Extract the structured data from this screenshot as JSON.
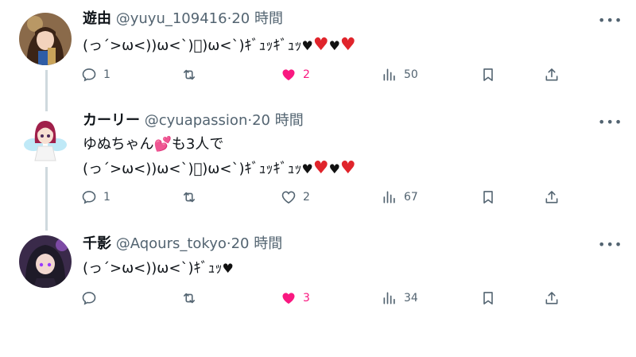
{
  "tweets": [
    {
      "name": "遊由",
      "handle": "@yuyu_109416",
      "separator": "·",
      "time": "20 時間",
      "line1": "(っ´>ω<))ω<`)ﾞ)ω<`)ｷﾞｭｯｷﾞｭｯ",
      "line2": "",
      "reply_count": "1",
      "retweet_count": "",
      "like_count": "2",
      "liked": true,
      "view_count": "50",
      "colors": {
        "bg": "#8a6a4a",
        "hair": "#3b2416",
        "skin": "#f3d3bd",
        "accent": "#c9a35a"
      }
    },
    {
      "name": "カーリー",
      "handle": "@cyuapassion",
      "separator": "·",
      "time": "20 時間",
      "line1": "ゆぬちゃん💕も3人で",
      "line2": "(っ´>ω<))ω<`)ﾞ)ω<`)ｷﾞｭｯｷﾞｭｯ",
      "reply_count": "1",
      "retweet_count": "",
      "like_count": "2",
      "liked": false,
      "view_count": "67",
      "colors": {
        "bg": "#ffffff",
        "hair": "#a0204a",
        "skin": "#f7e0d3",
        "accent": "#7fd3f0"
      }
    },
    {
      "name": "千影",
      "handle": "@Aqours_tokyo",
      "separator": "·",
      "time": "20 時間",
      "line1": "(っ´>ω<))ω<`)ｷﾞｭｯ",
      "line2": "",
      "reply_count": "",
      "retweet_count": "",
      "like_count": "3",
      "liked": true,
      "view_count": "34",
      "colors": {
        "bg": "#3a2a4a",
        "hair": "#1e1a28",
        "skin": "#f1d7cf",
        "accent": "#c06aff"
      }
    }
  ],
  "icons": {
    "reply": "reply-icon",
    "retweet": "retweet-icon",
    "like": "heart-icon",
    "views": "views-chart-icon",
    "bookmark": "bookmark-icon",
    "share": "share-icon",
    "more": "more-dots-icon"
  },
  "accent_colors": {
    "like": "#f91880",
    "muted": "#536471",
    "thread_line": "#cfd9de"
  }
}
